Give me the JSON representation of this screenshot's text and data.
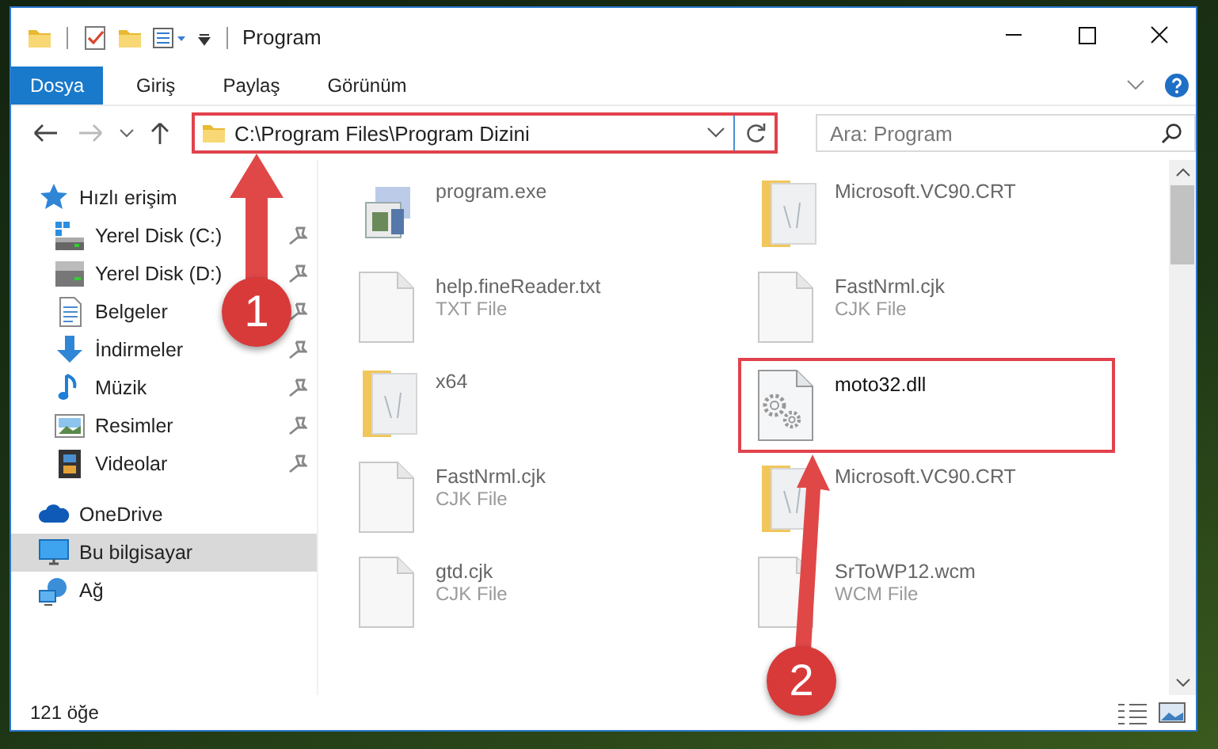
{
  "window": {
    "title": "Program"
  },
  "ribbon_tabs": [
    {
      "label": "Dosya",
      "selected": true
    },
    {
      "label": "Giriş",
      "selected": false
    },
    {
      "label": "Paylaş",
      "selected": false
    },
    {
      "label": "Görünüm",
      "selected": false
    }
  ],
  "address": {
    "path": "C:\\Program Files\\Program Dizini",
    "highlighted": true
  },
  "search": {
    "placeholder": "Ara: Program"
  },
  "sidebar": {
    "items": [
      {
        "label": "Hızlı erişim",
        "kind": "star",
        "selected": false,
        "children": [
          {
            "label": "Yerel Disk (C:)",
            "kind": "disk-c",
            "pinned": true,
            "selected": false
          },
          {
            "label": "Yerel Disk (D:)",
            "kind": "disk",
            "pinned": true,
            "selected": false
          },
          {
            "label": "Belgeler",
            "kind": "document",
            "pinned": true,
            "selected": false
          },
          {
            "label": "İndirmeler",
            "kind": "download",
            "pinned": true,
            "selected": false
          },
          {
            "label": "Müzik",
            "kind": "music",
            "pinned": true,
            "selected": false
          },
          {
            "label": "Resimler",
            "kind": "pictures",
            "pinned": true,
            "selected": false
          },
          {
            "label": "Videolar",
            "kind": "video",
            "pinned": true,
            "selected": false
          }
        ]
      },
      {
        "label": "OneDrive",
        "kind": "cloud",
        "selected": false
      },
      {
        "label": "Bu bilgisayar",
        "kind": "computer",
        "selected": true
      },
      {
        "label": "Ağ",
        "kind": "network",
        "selected": false
      }
    ]
  },
  "files": [
    {
      "name": "program.exe",
      "kind": "exe",
      "blurred": true,
      "highlighted": false
    },
    {
      "name": "Microsoft.VC90.CRT",
      "kind": "folder",
      "blurred": true,
      "highlighted": false
    },
    {
      "name": "help.fineReader.txt",
      "type": "TXT File",
      "kind": "file",
      "blurred": true,
      "highlighted": false
    },
    {
      "name": "FastNrml.cjk",
      "type": "CJK File",
      "kind": "file",
      "blurred": true,
      "highlighted": false
    },
    {
      "name": "x64",
      "kind": "folder",
      "blurred": true,
      "highlighted": false
    },
    {
      "name": "moto32.dll",
      "kind": "dll",
      "blurred": false,
      "highlighted": true
    },
    {
      "name": "FastNrml.cjk",
      "type": "CJK File",
      "kind": "file",
      "blurred": true,
      "highlighted": false
    },
    {
      "name": "Microsoft.VC90.CRT",
      "kind": "folder",
      "blurred": true,
      "highlighted": false
    },
    {
      "name": "gtd.cjk",
      "type": "CJK File",
      "kind": "file",
      "blurred": true,
      "highlighted": false
    },
    {
      "name": "SrToWP12.wcm",
      "type": "WCM File",
      "kind": "file",
      "blurred": true,
      "highlighted": false
    }
  ],
  "status_bar": {
    "count": "121 öğe"
  },
  "annotations": [
    {
      "label": "1"
    },
    {
      "label": "2"
    }
  ]
}
